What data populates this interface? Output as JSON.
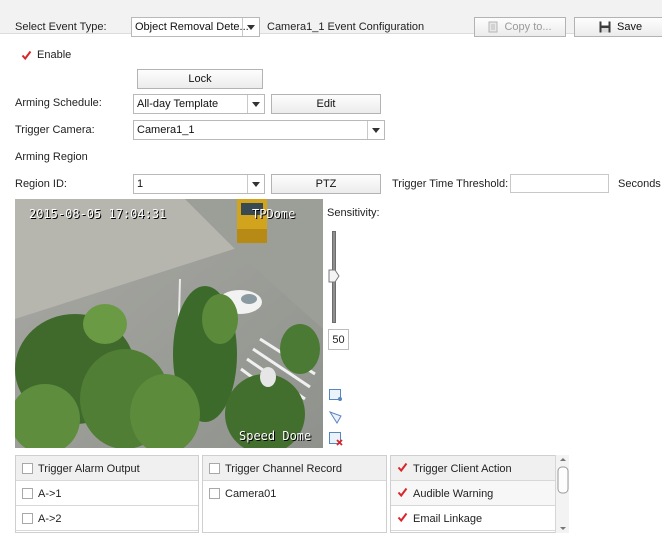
{
  "header": {
    "event_type_label": "Select Event Type:",
    "event_type_value": "Object Removal Dete...",
    "config_title": "Camera1_1 Event Configuration",
    "copy_label": "Copy to...",
    "save_label": "Save"
  },
  "enable": {
    "label": "Enable",
    "checked": true
  },
  "lock_label": "Lock",
  "arming_schedule": {
    "label": "Arming Schedule:",
    "value": "All-day Template",
    "edit_label": "Edit"
  },
  "trigger_camera": {
    "label": "Trigger Camera:",
    "value": "Camera1_1"
  },
  "arming_region_label": "Arming Region",
  "region": {
    "label": "Region ID:",
    "value": "1",
    "ptz_label": "PTZ",
    "threshold_label": "Trigger Time Threshold:",
    "threshold_value": "",
    "seconds_label": "Seconds"
  },
  "video": {
    "timestamp": "2015-08-05 17:04:31",
    "osd_top": "TPDome",
    "osd_bottom": "Speed Dome"
  },
  "sensitivity": {
    "label": "Sensitivity:",
    "value": "50",
    "level": 0.5
  },
  "alarm_output": {
    "header": "Trigger Alarm Output",
    "items": [
      {
        "label": "A->1",
        "checked": false
      },
      {
        "label": "A->2",
        "checked": false
      }
    ]
  },
  "channel_record": {
    "header": "Trigger Channel Record",
    "items": [
      {
        "label": "Camera01",
        "checked": false
      }
    ]
  },
  "client_action": {
    "header": "Trigger Client Action",
    "header_checked": true,
    "items": [
      {
        "label": "Audible Warning",
        "checked": true
      },
      {
        "label": "Email Linkage",
        "checked": true
      }
    ]
  },
  "colors": {
    "check": "#d9262c",
    "topbar": "#f2f2f2",
    "border": "#b9b9b9"
  }
}
